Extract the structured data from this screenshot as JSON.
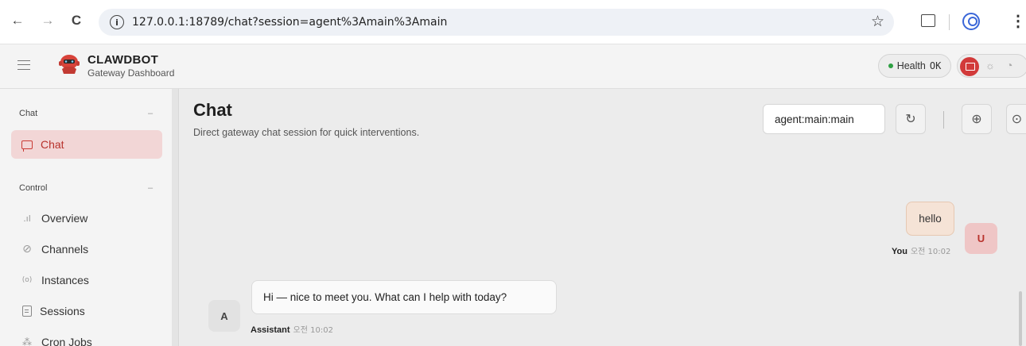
{
  "browser": {
    "back": "←",
    "forward": "→",
    "reload": "C",
    "info": "i",
    "url": "127.0.0.1:18789/chat?session=agent%3Amain%3Amain",
    "star": "☆",
    "menu": "⋮"
  },
  "header": {
    "brand_title": "CLAWDBOT",
    "brand_sub": "Gateway Dashboard",
    "health_label": "Health",
    "health_value": "OK",
    "sun": "☼",
    "moon": "◔"
  },
  "sidebar": {
    "groups": [
      {
        "title": "Chat",
        "collapse": "–"
      },
      {
        "title": "Control",
        "collapse": "–"
      }
    ],
    "items": [
      {
        "label": "Chat",
        "icon": "chat-bubble"
      },
      {
        "label": "Overview",
        "icon": ".ıl"
      },
      {
        "label": "Channels",
        "icon": "⊘"
      },
      {
        "label": "Instances",
        "icon": "(o)"
      },
      {
        "label": "Sessions",
        "icon": "document"
      },
      {
        "label": "Cron Jobs",
        "icon": "⁂"
      }
    ]
  },
  "main": {
    "title": "Chat",
    "subtitle": "Direct gateway chat session for quick interventions.",
    "session_value": "agent:main:main",
    "refresh_icon": "↻",
    "focus_icon": "⊕",
    "screen_icon": "⊙"
  },
  "messages": [
    {
      "role": "user",
      "text": "hello",
      "sender": "You",
      "time": "오전 10:02",
      "avatar": "U"
    },
    {
      "role": "assistant",
      "text": "Hi — nice to meet you. What can I help with today?",
      "sender": "Assistant",
      "time": "오전 10:02",
      "avatar": "A"
    }
  ],
  "colors": {
    "accent": "#d23a3a",
    "active_bg": "#f2d6d6",
    "user_bubble": "#f5e3d6",
    "health_dot": "#2ea043"
  }
}
